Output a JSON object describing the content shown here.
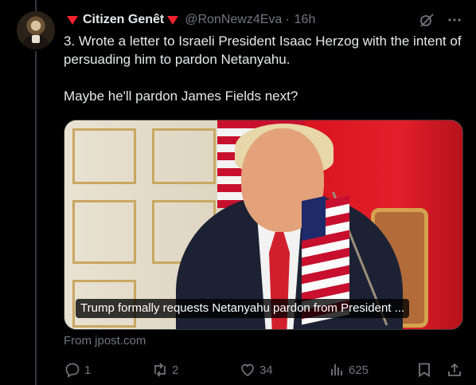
{
  "post": {
    "author_name": "Citizen Genêt",
    "handle": "@RonNewz4Eva",
    "separator": "·",
    "time": "16h",
    "paragraphs": [
      "3. Wrote a letter to Israeli President Isaac Herzog with the intent of persuading him to pardon Netanyahu.",
      "Maybe he'll pardon James Fields next?"
    ]
  },
  "media": {
    "caption": "Trump formally requests Netanyahu pardon from President ..."
  },
  "link_source": "From jpost.com",
  "actions": {
    "replies": "1",
    "reposts": "2",
    "likes": "34",
    "views": "625"
  },
  "colors": {
    "accent_red": "#f4212e",
    "muted": "#71767b",
    "background": "#000000"
  },
  "icons": [
    "red-triangle-icon",
    "grok-icon",
    "more-icon",
    "reply-icon",
    "repost-icon",
    "like-icon",
    "views-icon",
    "bookmark-icon",
    "share-icon"
  ]
}
